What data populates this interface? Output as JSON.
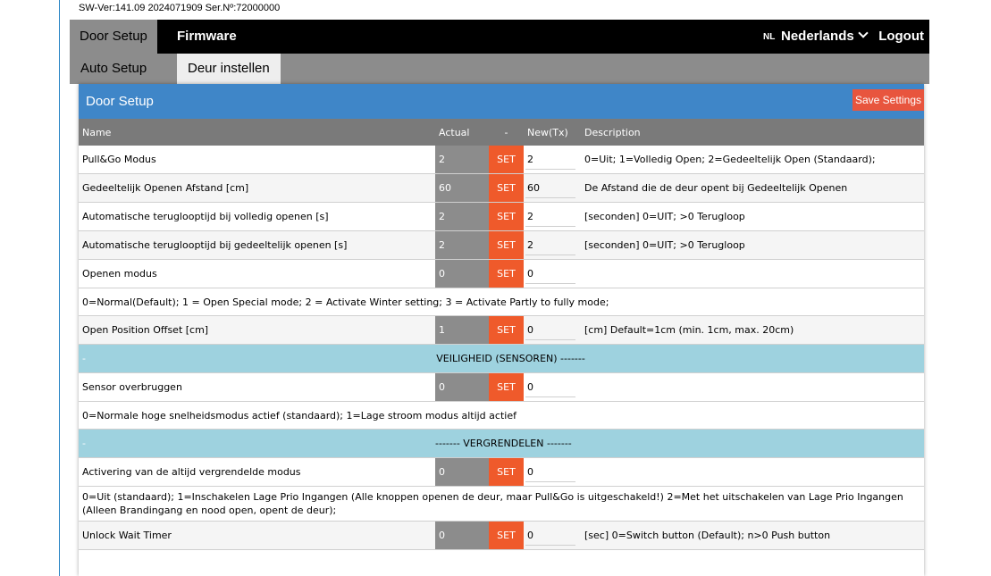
{
  "version": "SW-Ver:141.09 2024071909 Ser.Nº:72000000",
  "nav": {
    "tab_door_setup": "Door Setup",
    "tab_firmware": "Firmware",
    "lang_code": "NL",
    "lang_label": "Nederlands",
    "logout": "Logout"
  },
  "subnav": {
    "auto_setup": "Auto Setup",
    "deur_instellen": "Deur instellen"
  },
  "panel": {
    "title": "Door Setup",
    "save_label": "Save Settings"
  },
  "table": {
    "headers": [
      "Name",
      "Actual",
      "-",
      "New(Tx)",
      "Description"
    ],
    "set_label": "SET",
    "rows": [
      {
        "name": "Pull&Go Modus",
        "actual": "2",
        "new": "2",
        "desc": "0=Uit; 1=Volledig Open; 2=Gedeeltelijk Open (Standaard);"
      },
      {
        "name": "Gedeeltelijk Openen Afstand [cm]",
        "actual": "60",
        "new": "60",
        "desc": "De Afstand die de deur opent bij Gedeeltelijk Openen"
      },
      {
        "name": "Automatische teruglooptijd bij volledig openen [s]",
        "actual": "2",
        "new": "2",
        "desc": "[seconden] 0=UIT; >0 Terugloop"
      },
      {
        "name": "Automatische teruglooptijd bij gedeeltelijk openen [s]",
        "actual": "2",
        "new": "2",
        "desc": "[seconden] 0=UIT; >0 Terugloop"
      },
      {
        "name": "Openen modus",
        "actual": "0",
        "new": "0",
        "desc": ""
      },
      {
        "name": "Open Position Offset [cm]",
        "actual": "1",
        "new": "0",
        "desc": "[cm] Default=1cm (min. 1cm, max. 20cm)"
      },
      {
        "name": "Sensor overbruggen",
        "actual": "0",
        "new": "0",
        "desc": ""
      },
      {
        "name": "Activering van de altijd vergrendelde modus",
        "actual": "0",
        "new": "0",
        "desc": ""
      },
      {
        "name": "Unlock Wait Timer",
        "actual": "0",
        "new": "0",
        "desc": "[sec] 0=Switch button (Default); n>0 Push button"
      }
    ],
    "notes": {
      "openen_modus": "0=Normal(Default); 1 = Open Special mode; 2 = Activate Winter setting; 3 = Activate Partly to fully mode;",
      "sensor": "0=Normale hoge snelheidsmodus actief (standaard); 1=Lage stroom modus altijd actief",
      "vergrendeld": "0=Uit (standaard); 1=Inschakelen Lage Prio Ingangen (Alle knoppen openen de deur, maar Pull&Go is uitgeschakeld!) 2=Met het uitschakelen van Lage Prio Ingangen (Alleen Brandingang en nood open, opent de deur);"
    },
    "sections": [
      {
        "dash": "-",
        "title": "------- VEILIGHEID (SENSOREN) -------"
      },
      {
        "dash": "-",
        "title": "------- VERGRENDELEN -------"
      }
    ]
  },
  "colors": {
    "header_blue": "#3f86c8",
    "set_orange": "#ef5a2b",
    "section_teal": "#9ed2df",
    "actual_gray": "#8c8c8c"
  }
}
